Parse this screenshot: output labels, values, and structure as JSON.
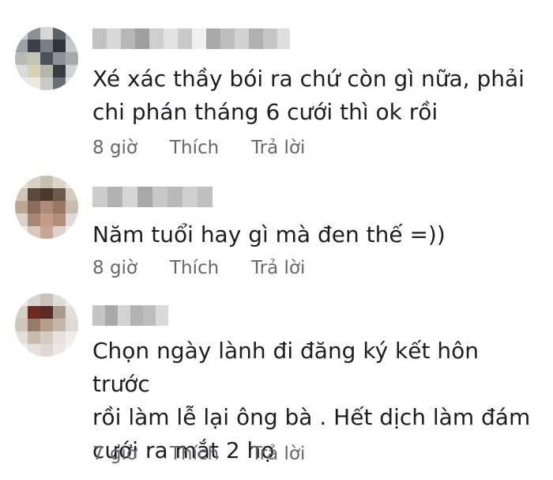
{
  "comments": [
    {
      "text": "Xé xác thầy bói ra chứ còn gì nữa, phải\nchi phán tháng 6 cưới thì ok rồi",
      "time": "8 giờ",
      "like_label": "Thích",
      "reply_label": "Trả lời"
    },
    {
      "text": "Năm tuổi hay gì mà đen thế =))",
      "time": "8 giờ",
      "like_label": "Thích",
      "reply_label": "Trả lời"
    },
    {
      "text": "Chọn ngày lành đi đăng ký kết hôn trước\nrồi làm lễ lại ông bà . Hết dịch làm đám\ncưới ra mắt 2 họ",
      "time": "7 giờ",
      "like_label": "Thích",
      "reply_label": "Trả lời"
    }
  ]
}
